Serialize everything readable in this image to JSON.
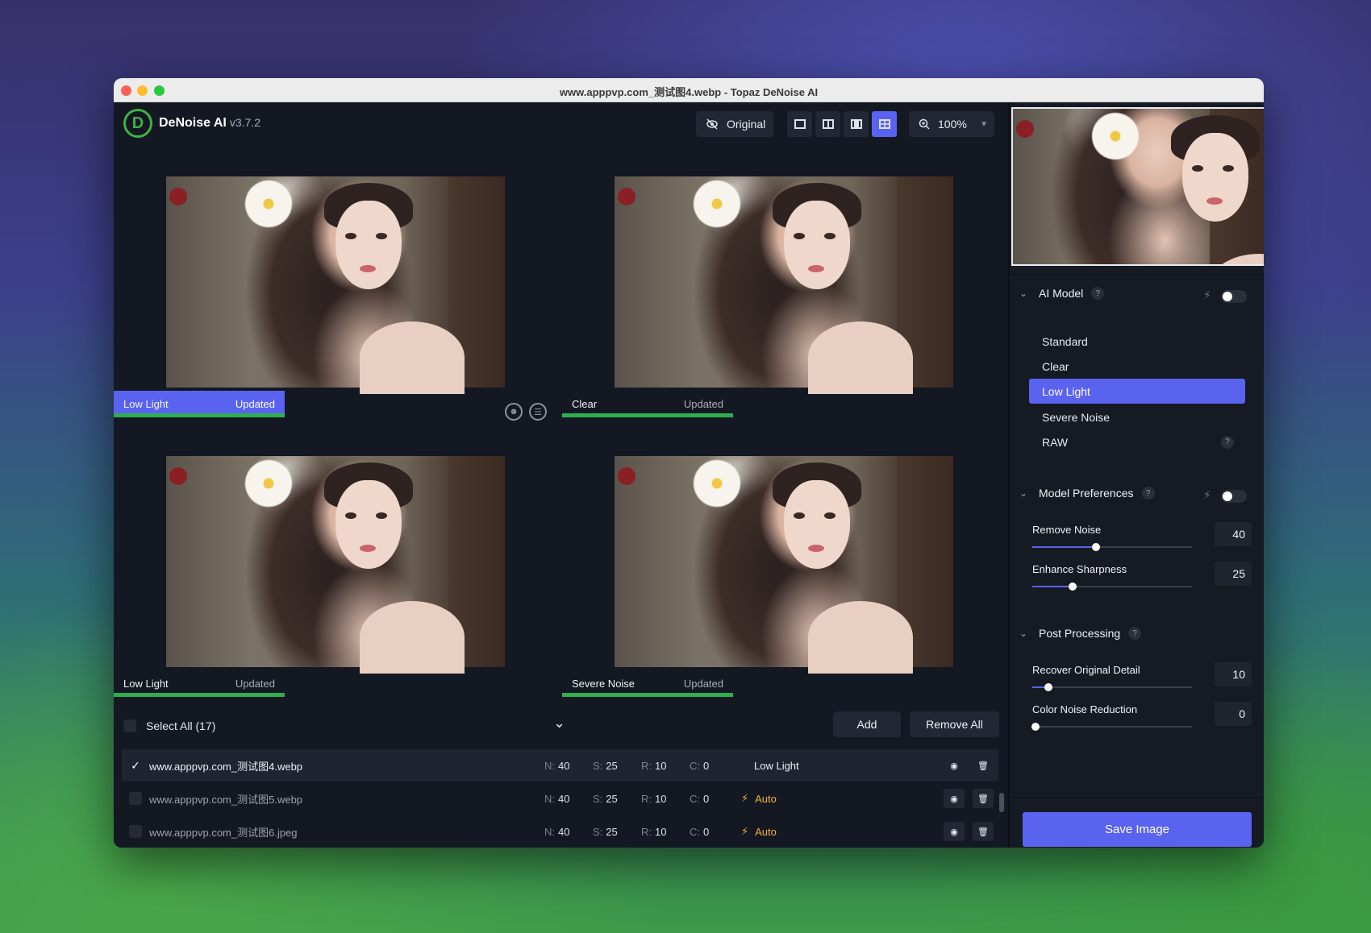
{
  "window": {
    "title": "www.apppvp.com_测试图4.webp - Topaz DeNoise AI"
  },
  "app": {
    "logo_letter": "D",
    "name": "DeNoise AI",
    "version": "v3.7.2"
  },
  "toolbar": {
    "original_label": "Original",
    "zoom_value": "100%",
    "active_view": "quad"
  },
  "panes": [
    {
      "model": "Low Light",
      "status": "Updated",
      "active": true
    },
    {
      "model": "Clear",
      "status": "Updated",
      "active": false
    },
    {
      "model": "Low Light",
      "status": "Updated",
      "active": false
    },
    {
      "model": "Severe Noise",
      "status": "Updated",
      "active": false
    }
  ],
  "filelist": {
    "select_all_label": "Select All (17)",
    "add_label": "Add",
    "remove_all_label": "Remove All",
    "stat_labels": {
      "n": "N:",
      "s": "S:",
      "r": "R:",
      "c": "C:"
    },
    "rows": [
      {
        "name": "www.apppvp.com_测试图4.webp",
        "n": "40",
        "s": "25",
        "r": "10",
        "c": "0",
        "model": "Low Light",
        "auto": false,
        "checked": true
      },
      {
        "name": "www.apppvp.com_测试图5.webp",
        "n": "40",
        "s": "25",
        "r": "10",
        "c": "0",
        "model": "Auto",
        "auto": true,
        "checked": false
      },
      {
        "name": "www.apppvp.com_测试图6.jpeg",
        "n": "40",
        "s": "25",
        "r": "10",
        "c": "0",
        "model": "Auto",
        "auto": true,
        "checked": false
      }
    ]
  },
  "sidebar": {
    "ai_model": {
      "title": "AI Model",
      "help": "?",
      "models": [
        "Standard",
        "Clear",
        "Low Light",
        "Severe Noise",
        "RAW"
      ],
      "selected": "Low Light"
    },
    "model_prefs": {
      "title": "Model Preferences",
      "help": "?",
      "remove_noise": {
        "label": "Remove Noise",
        "value": "40"
      },
      "enhance_sharpness": {
        "label": "Enhance Sharpness",
        "value": "25"
      }
    },
    "post_processing": {
      "title": "Post Processing",
      "help": "?",
      "recover_detail": {
        "label": "Recover Original Detail",
        "value": "10"
      },
      "color_noise": {
        "label": "Color Noise Reduction",
        "value": "0"
      }
    },
    "save_label": "Save Image"
  },
  "colors": {
    "accent": "#5a63f0",
    "progress": "#2fae4e",
    "auto": "#f2b233",
    "logo": "#41b046"
  }
}
